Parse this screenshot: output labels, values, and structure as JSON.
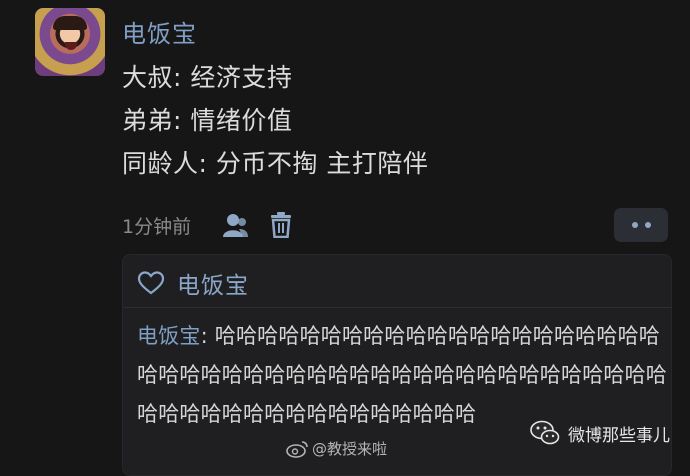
{
  "post": {
    "author": "电饭宝",
    "lines": [
      "大叔: 经济支持",
      "弟弟: 情绪价值",
      "同龄人: 分币不掏 主打陪伴"
    ],
    "time": "1分钟前"
  },
  "reply": {
    "author": "电饭宝",
    "quote_name": "电饭宝",
    "quote_sep": ": ",
    "quote_text": "哈哈哈哈哈哈哈哈哈哈哈哈哈哈哈哈哈哈哈哈哈哈哈哈哈哈哈哈哈哈哈哈哈哈哈哈哈哈哈哈哈哈哈哈哈哈哈哈哈哈哈哈哈哈哈哈哈哈哈哈哈哈"
  },
  "watermark": {
    "text": "@教授来啦"
  },
  "wechat": {
    "text": "微博那些事儿"
  },
  "colors": {
    "accent": "#7f9fc4",
    "background": "#161616",
    "panel": "#1f1f21"
  }
}
